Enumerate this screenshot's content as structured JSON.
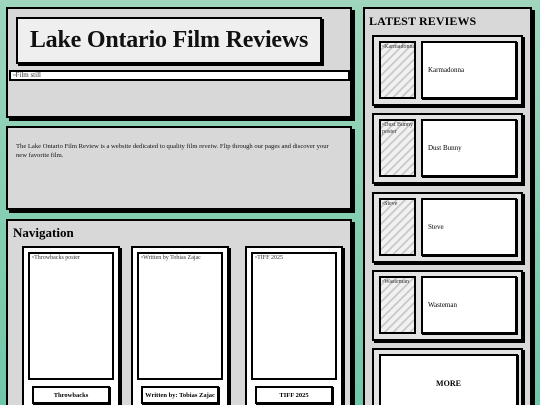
{
  "header": {
    "title": "Lake Ontario Film Reviews",
    "still_alt": "Film still"
  },
  "about": {
    "text": "The Lake Ontario Film Review is a website dedicated to quality film reveiw. Flip through our pages and discover your new favorite film."
  },
  "nav": {
    "heading": "Navigation",
    "cards": [
      {
        "img_alt": "Throwbacks poster",
        "label": "Throwbacks"
      },
      {
        "img_alt": "Written by Tobias Zajac",
        "label": "Written by: Tobias Zajac"
      },
      {
        "img_alt": "TIFF 2025",
        "label": "TIFF 2025"
      }
    ]
  },
  "reviews": {
    "heading": "LATEST REVIEWS",
    "items": [
      {
        "img_alt": "Karmadonna",
        "title": "Karmadonna"
      },
      {
        "img_alt": "Dust Bunny poster",
        "title": "Dust Bunny"
      },
      {
        "img_alt": "Steve",
        "title": "Steve"
      },
      {
        "img_alt": "Wasteman",
        "title": "Wasteman"
      }
    ],
    "more_label": "MORE"
  }
}
